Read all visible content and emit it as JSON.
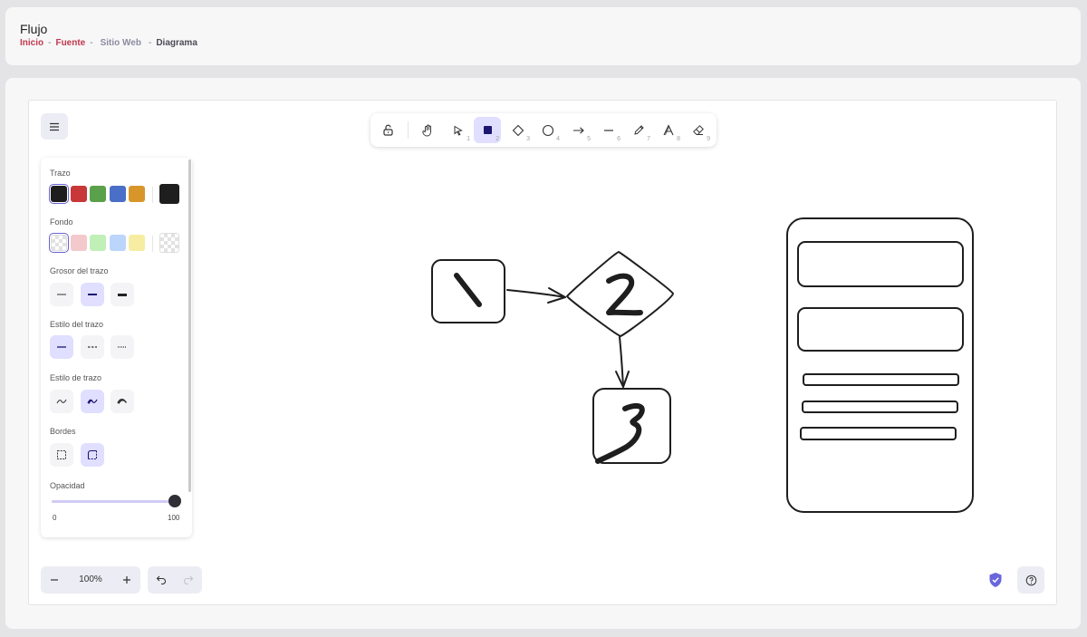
{
  "header": {
    "title": "Flujo",
    "breadcrumb": [
      "Inicio",
      "Fuente",
      "Sitio Web",
      "Diagrama"
    ],
    "separator": "-"
  },
  "toolbar": {
    "tools": [
      {
        "name": "lock",
        "key": ""
      },
      {
        "name": "hand",
        "key": ""
      },
      {
        "name": "selection",
        "key": "1"
      },
      {
        "name": "rectangle",
        "key": "2"
      },
      {
        "name": "diamond",
        "key": "3"
      },
      {
        "name": "ellipse",
        "key": "4"
      },
      {
        "name": "arrow",
        "key": "5"
      },
      {
        "name": "line",
        "key": "6"
      },
      {
        "name": "pencil",
        "key": "7"
      },
      {
        "name": "text",
        "key": "8"
      },
      {
        "name": "eraser",
        "key": "9"
      }
    ],
    "active_tool": "rectangle"
  },
  "properties": {
    "stroke_label": "Trazo",
    "stroke_colors": [
      "#1e1e1e",
      "#c83838",
      "#5ba04a",
      "#4a6fc8",
      "#d8962a"
    ],
    "stroke_current": "#1e1e1e",
    "background_label": "Fondo",
    "background_colors": [
      "transparent",
      "#f3c9cc",
      "#c0f0b8",
      "#bcd6fb",
      "#f7eda2"
    ],
    "background_current": "transparent",
    "stroke_width_label": "Grosor del trazo",
    "stroke_style_label": "Estilo del trazo",
    "sloppiness_label": "Estilo de trazo",
    "edges_label": "Bordes",
    "opacity_label": "Opacidad",
    "opacity_min": "0",
    "opacity_max": "100",
    "opacity_value": 100
  },
  "footer": {
    "zoom": "100%"
  },
  "colors": {
    "accent": "#6965db",
    "accent_light": "#e0dfff",
    "breadcrumb_link": "#c0394f"
  }
}
